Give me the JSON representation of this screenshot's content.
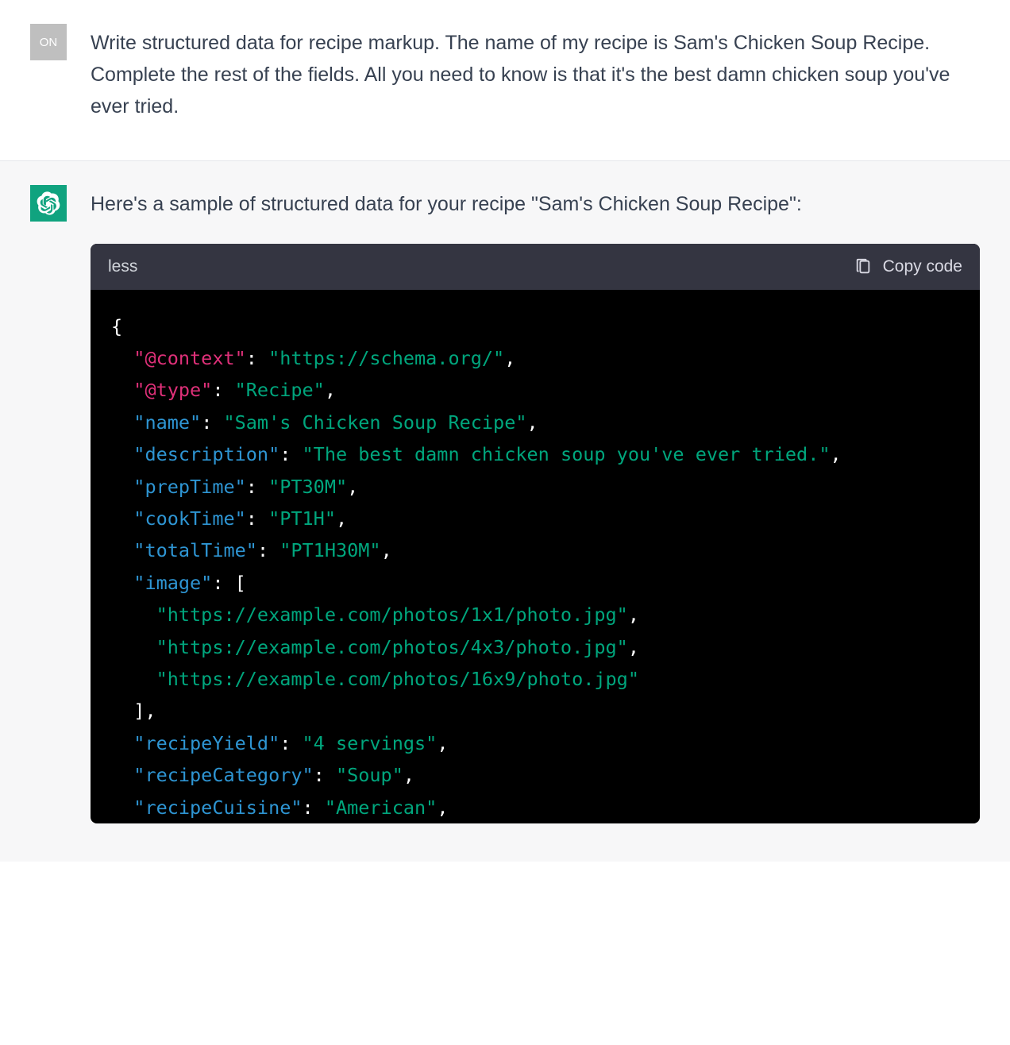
{
  "user_avatar_text": "ON",
  "user_message": "Write structured data for recipe markup. The name of my recipe is Sam's Chicken Soup Recipe. Complete the rest of the fields. All you need to know is that it's the best damn chicken soup you've ever tried.",
  "assistant_intro": "Here's a sample of structured data for your recipe \"Sam's Chicken Soup Recipe\":",
  "code_lang": "less",
  "copy_label": "Copy code",
  "code": {
    "line1_open": "{",
    "l2_key": "\"@context\"",
    "l2_val": "\"https://schema.org/\"",
    "l3_key": "\"@type\"",
    "l3_val": "\"Recipe\"",
    "l4_key": "\"name\"",
    "l4_val": "\"Sam's Chicken Soup Recipe\"",
    "l5_key": "\"description\"",
    "l5_val": "\"The best damn chicken soup you've ever tried.\"",
    "l6_key": "\"prepTime\"",
    "l6_val": "\"PT30M\"",
    "l7_key": "\"cookTime\"",
    "l7_val": "\"PT1H\"",
    "l8_key": "\"totalTime\"",
    "l8_val": "\"PT1H30M\"",
    "l9_key": "\"image\"",
    "l10_val": "\"https://example.com/photos/1x1/photo.jpg\"",
    "l11_val": "\"https://example.com/photos/4x3/photo.jpg\"",
    "l12_val": "\"https://example.com/photos/16x9/photo.jpg\"",
    "l14_key": "\"recipeYield\"",
    "l14_val": "\"4 servings\"",
    "l15_key": "\"recipeCategory\"",
    "l15_val": "\"Soup\"",
    "l16_key": "\"recipeCuisine\"",
    "l16_val": "\"American\""
  }
}
